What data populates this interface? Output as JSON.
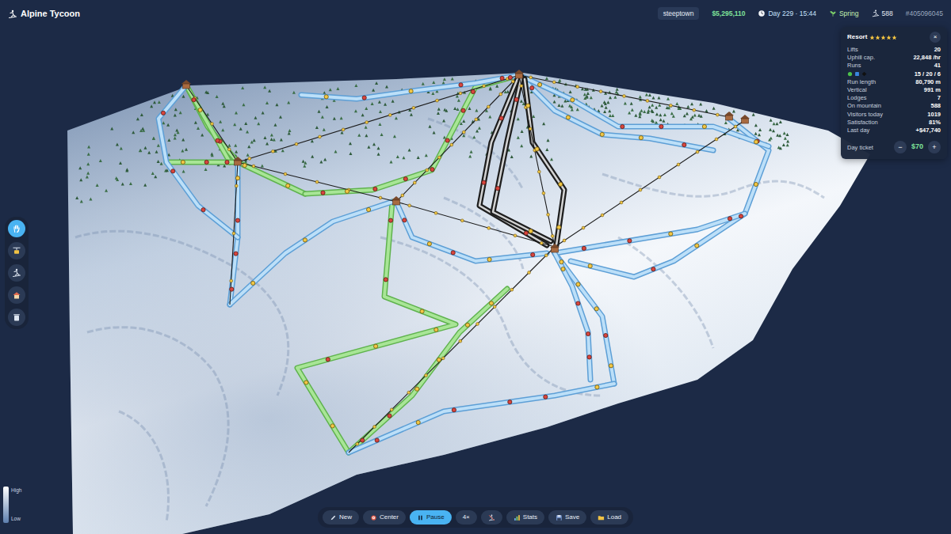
{
  "app": {
    "title": "Alpine Tycoon"
  },
  "stats": [
    {
      "text": "steeptown",
      "kind": "town"
    },
    {
      "text": "$5,295,110",
      "kind": "money"
    },
    {
      "text": "Day 229 · 15:44",
      "kind": "clock"
    },
    {
      "text": "Spring",
      "kind": "season"
    },
    {
      "text": "588",
      "kind": "skiers"
    },
    {
      "text": "#405096045",
      "kind": "seed"
    }
  ],
  "resort": {
    "title": "Resort",
    "stars": 5,
    "close": "×",
    "rows": [
      {
        "kind": "text",
        "label": "Lifts",
        "value": "20"
      },
      {
        "kind": "text",
        "label": "Uphill cap.",
        "value": "22,848 /hr"
      },
      {
        "kind": "text",
        "label": "Runs",
        "value": "41"
      },
      {
        "kind": "difficulty",
        "label": "",
        "value": "15 / 20 / 6"
      },
      {
        "kind": "text",
        "label": "Run length",
        "value": "80,790 m"
      },
      {
        "kind": "text",
        "label": "Vertical",
        "value": "991 m"
      },
      {
        "kind": "text",
        "label": "Lodges",
        "value": "7"
      },
      {
        "kind": "text",
        "label": "On mountain",
        "value": "588"
      },
      {
        "kind": "text",
        "label": "Visitors today",
        "value": "1019"
      },
      {
        "kind": "text",
        "label": "Satisfaction",
        "value": "81%"
      },
      {
        "kind": "text",
        "label": "Last day",
        "value": "+$47,740"
      }
    ],
    "ticket": {
      "label": "Day ticket",
      "minus": "−",
      "price": "$70",
      "plus": "+"
    }
  },
  "tools": [
    {
      "selected": true
    },
    {
      "selected": false
    },
    {
      "selected": false
    },
    {
      "selected": false
    },
    {
      "selected": false
    }
  ],
  "buttons": [
    {
      "label": "New",
      "selected": false
    },
    {
      "label": "Center",
      "selected": false
    },
    {
      "label": "Pause",
      "selected": true
    },
    {
      "label": "4×",
      "selected": false
    },
    {
      "label": "",
      "selected": false
    },
    {
      "label": "Stats",
      "selected": false
    },
    {
      "label": "Save",
      "selected": false
    },
    {
      "label": "Load",
      "selected": false
    }
  ],
  "legend": {
    "high": "High",
    "low": "Low"
  },
  "map": {
    "runs": [
      {
        "kind": "green",
        "skiers": 4
      },
      {
        "kind": "green",
        "skiers": 2
      },
      {
        "kind": "green",
        "skiers": 3
      },
      {
        "kind": "green",
        "skiers": 8
      },
      {
        "kind": "green",
        "skiers": 6
      },
      {
        "kind": "green",
        "skiers": 9
      },
      {
        "kind": "blue",
        "skiers": 4
      },
      {
        "kind": "blue",
        "skiers": 5
      },
      {
        "kind": "blue",
        "skiers": 5
      },
      {
        "kind": "blue",
        "skiers": 6
      },
      {
        "kind": "blue",
        "skiers": 5
      },
      {
        "kind": "blue",
        "skiers": 6
      },
      {
        "kind": "blue",
        "skiers": 4
      },
      {
        "kind": "blue",
        "skiers": 3
      },
      {
        "kind": "blue",
        "skiers": 6
      },
      {
        "kind": "blue",
        "skiers": 5
      },
      {
        "kind": "black",
        "skiers": 3
      },
      {
        "kind": "black",
        "skiers": 3
      },
      {
        "kind": "black",
        "skiers": 4
      },
      {
        "kind": "blue",
        "skiers": 4
      },
      {
        "kind": "blue",
        "skiers": 3
      }
    ],
    "lifts": [
      {
        "chairs": 3
      },
      {
        "chairs": 12
      },
      {
        "chairs": 10
      },
      {
        "chairs": 12
      },
      {
        "chairs": 8
      },
      {
        "chairs": 10
      },
      {
        "chairs": 6
      },
      {
        "chairs": 5
      },
      {
        "chairs": 9
      },
      {
        "chairs": 3
      }
    ],
    "lodges": [
      {
        "kind": "lodge"
      },
      {
        "kind": "lodge"
      },
      {
        "kind": "lodge"
      },
      {
        "kind": "lodge"
      },
      {
        "kind": "lodge"
      },
      {
        "kind": "lodge"
      },
      {
        "kind": "lodge"
      }
    ]
  }
}
